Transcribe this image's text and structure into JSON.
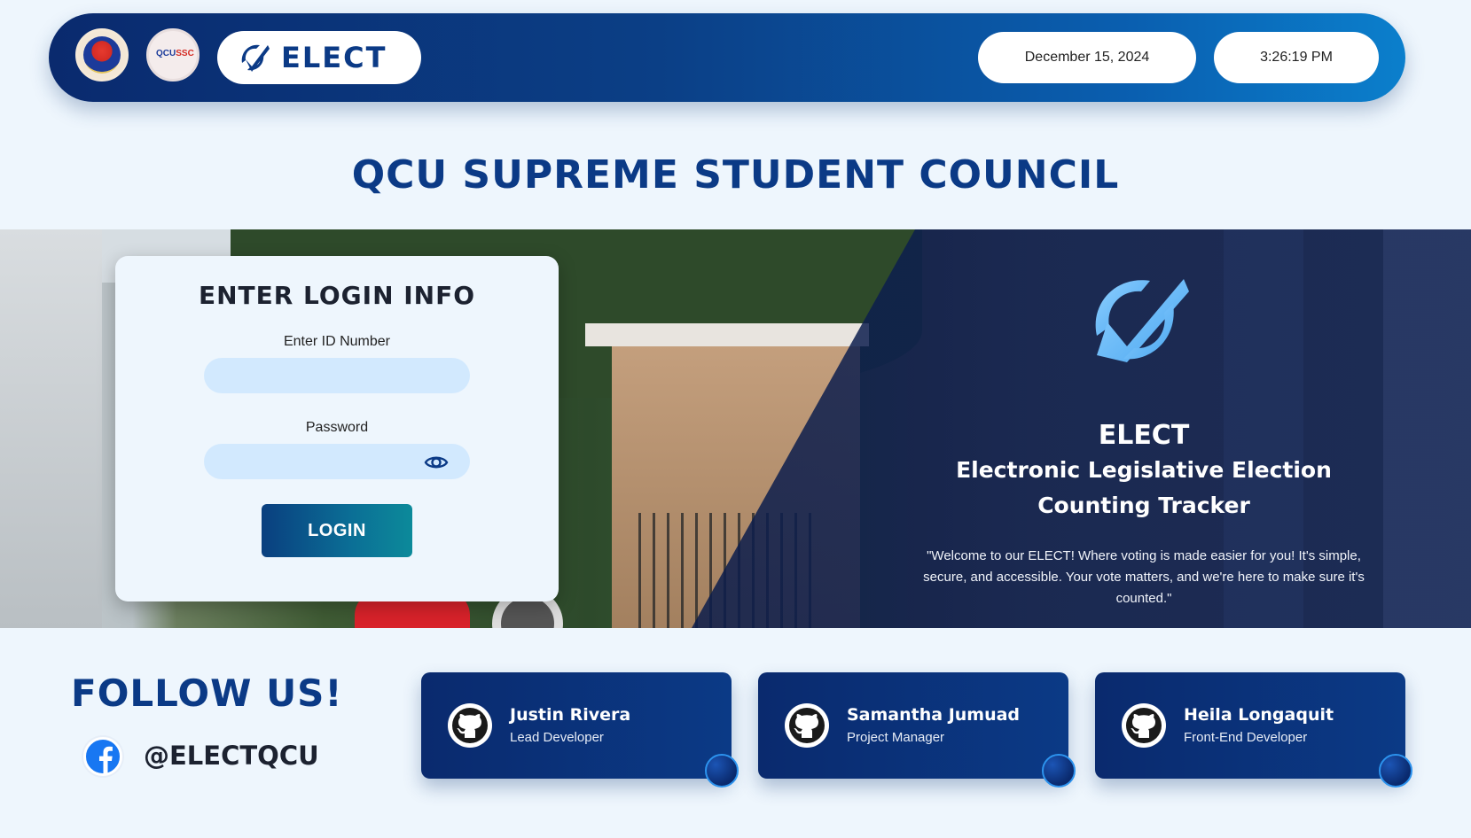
{
  "header": {
    "brand": "ELECT",
    "date": "December 15, 2024",
    "time": "3:26:19 PM"
  },
  "title": "QCU SUPREME STUDENT COUNCIL",
  "login": {
    "heading": "ENTER LOGIN INFO",
    "id_label": "Enter ID Number",
    "id_value": "",
    "password_label": "Password",
    "password_value": "",
    "button_label": "LOGIN"
  },
  "hero": {
    "app_name": "ELECT",
    "app_subtitle_line1": "Electronic Legislative Election",
    "app_subtitle_line2": "Counting Tracker",
    "welcome": "\"Welcome to our ELECT! Where voting is made easier for you! It's simple, secure, and accessible. Your vote matters, and we're here to make sure it's counted.\""
  },
  "follow": {
    "title": "FOLLOW US!",
    "handle": "@ELECTQCU",
    "icon": "facebook-icon"
  },
  "developers": [
    {
      "name": "Justin Rivera",
      "role": "Lead Developer",
      "icon": "github-icon"
    },
    {
      "name": "Samantha Jumuad",
      "role": "Project Manager",
      "icon": "github-icon"
    },
    {
      "name": "Heila Longaquit",
      "role": "Front-End Developer",
      "icon": "github-icon"
    }
  ],
  "colors": {
    "primary": "#0b3a86",
    "header_start": "#0a2a6e",
    "header_end": "#0b7fcc",
    "input_bg": "#d2e9fe",
    "page_bg": "#eef6fd"
  }
}
